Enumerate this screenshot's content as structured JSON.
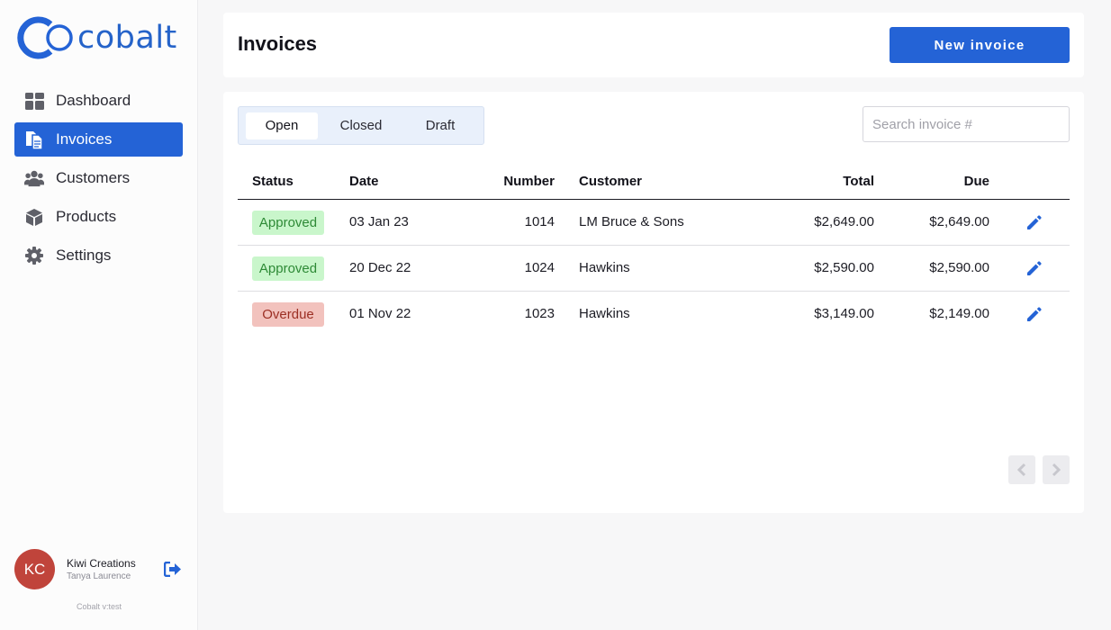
{
  "brand": {
    "name": "cobalt",
    "accent": "#2463d6"
  },
  "sidebar": {
    "items": [
      {
        "label": "Dashboard",
        "icon": "dashboard-grid-icon"
      },
      {
        "label": "Invoices",
        "icon": "invoice-documents-icon",
        "active": true
      },
      {
        "label": "Customers",
        "icon": "users-group-icon"
      },
      {
        "label": "Products",
        "icon": "box-icon"
      },
      {
        "label": "Settings",
        "icon": "gear-icon"
      }
    ],
    "user": {
      "initials": "KC",
      "company": "Kiwi Creations",
      "name": "Tanya Laurence"
    },
    "version": "Cobalt v:test"
  },
  "header": {
    "title": "Invoices",
    "new_button_label": "New invoice"
  },
  "tabs": [
    {
      "label": "Open",
      "active": true
    },
    {
      "label": "Closed"
    },
    {
      "label": "Draft"
    }
  ],
  "search": {
    "placeholder": "Search invoice #",
    "value": ""
  },
  "table": {
    "columns": {
      "status": "Status",
      "date": "Date",
      "number": "Number",
      "customer": "Customer",
      "total": "Total",
      "due": "Due"
    },
    "rows": [
      {
        "status": "Approved",
        "date": "03 Jan 23",
        "number": "1014",
        "customer": "LM Bruce & Sons",
        "total": "$2,649.00",
        "due": "$2,649.00"
      },
      {
        "status": "Approved",
        "date": "20 Dec 22",
        "number": "1024",
        "customer": "Hawkins",
        "total": "$2,590.00",
        "due": "$2,590.00"
      },
      {
        "status": "Overdue",
        "date": "01 Nov 22",
        "number": "1023",
        "customer": "Hawkins",
        "total": "$3,149.00",
        "due": "$2,149.00"
      }
    ]
  },
  "colors": {
    "approved_bg": "#c9f6cb",
    "approved_text": "#2e8a36",
    "overdue_bg": "#f2c2bd",
    "overdue_text": "#9c2f24"
  }
}
